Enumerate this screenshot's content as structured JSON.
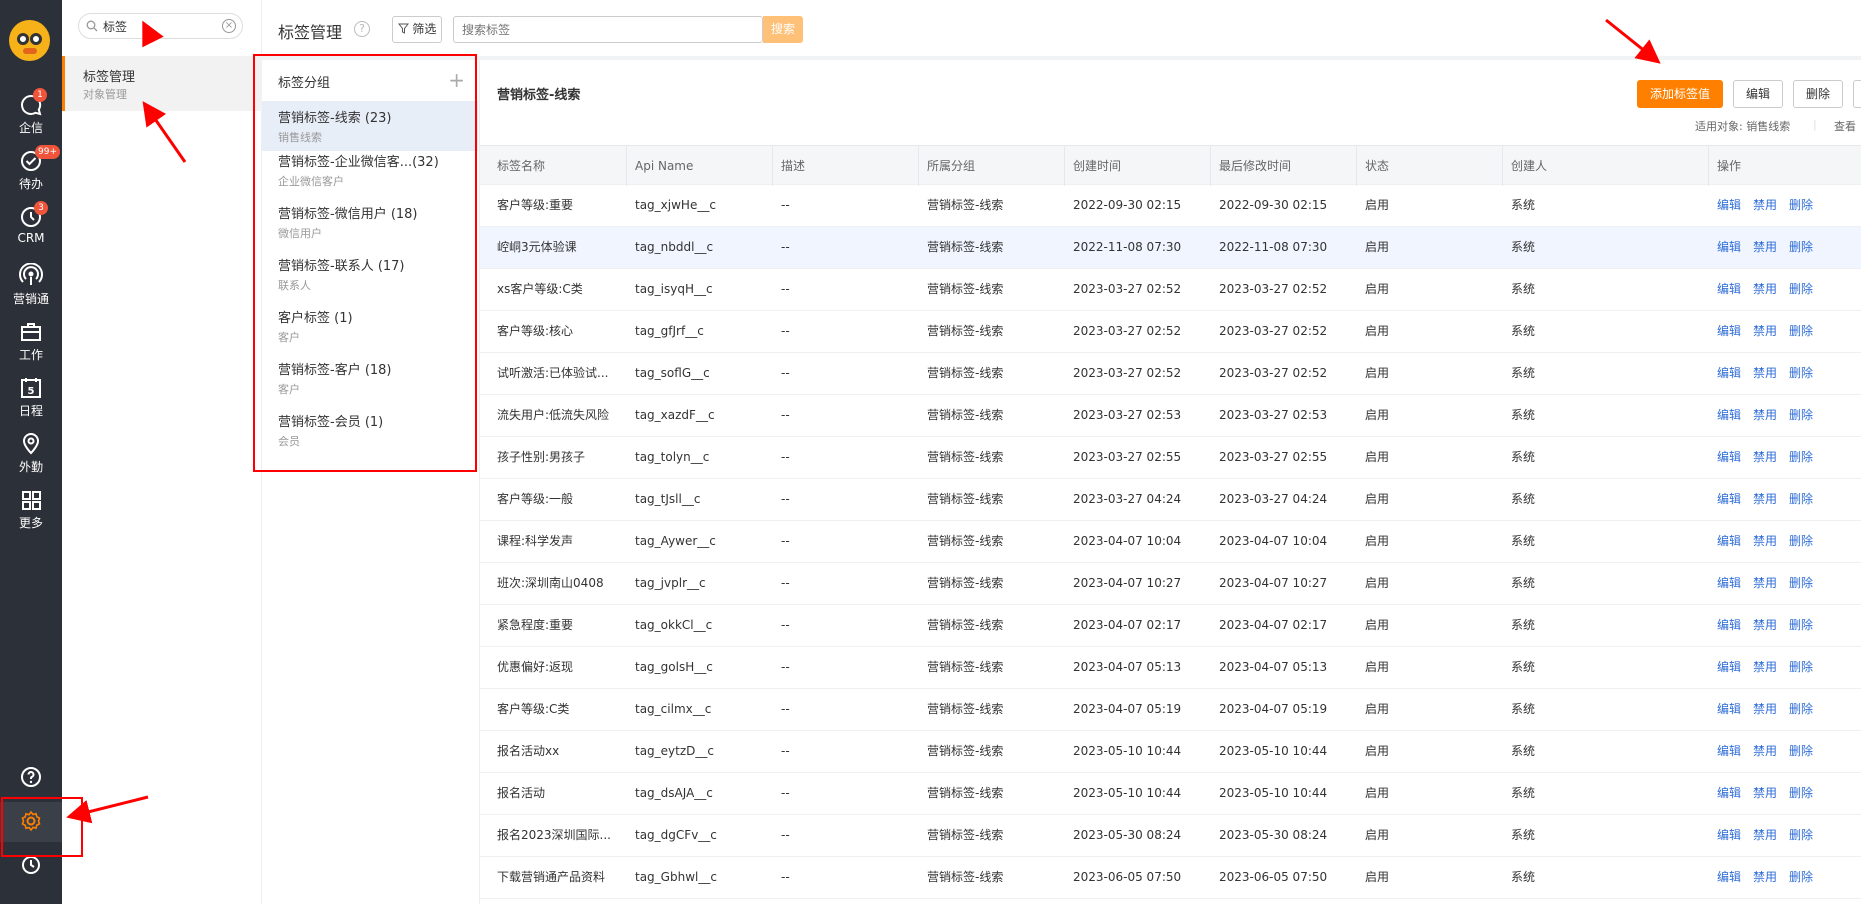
{
  "app": {
    "logo": "app-logo"
  },
  "rail": {
    "items": [
      {
        "label": "企信",
        "icon": "chat-icon",
        "badge": "1"
      },
      {
        "label": "待办",
        "icon": "check-circle-icon",
        "badge": "99+"
      },
      {
        "label": "CRM",
        "icon": "clock-icon",
        "badge": "3"
      },
      {
        "label": "营销通",
        "icon": "broadcast-icon",
        "badge": ""
      },
      {
        "label": "工作",
        "icon": "briefcase-icon",
        "badge": ""
      },
      {
        "label": "日程",
        "icon": "calendar-icon",
        "badge": "",
        "day": "5"
      },
      {
        "label": "外勤",
        "icon": "location-pin-icon",
        "badge": ""
      },
      {
        "label": "更多",
        "icon": "grid-icon",
        "badge": ""
      }
    ],
    "bottom": [
      "help-icon",
      "gear-icon",
      "history-icon"
    ]
  },
  "panel": {
    "search_value": "标签",
    "nav": {
      "title": "标签管理",
      "subtitle": "对象管理"
    }
  },
  "header": {
    "title": "标签管理",
    "help": "?",
    "filter_label": "筛选",
    "search_placeholder": "搜索标签",
    "search_button": "搜索"
  },
  "groups": {
    "header": "标签分组",
    "add": "+",
    "items": [
      {
        "name": "营销标签-线索 (23)",
        "desc": "销售线索",
        "active": true
      },
      {
        "name": "营销标签-企业微信客...(32)",
        "desc": "企业微信客户",
        "active": false
      },
      {
        "name": "营销标签-微信用户 (18)",
        "desc": "微信用户",
        "active": false
      },
      {
        "name": "营销标签-联系人 (17)",
        "desc": "联系人",
        "active": false
      },
      {
        "name": "客户标签 (1)",
        "desc": "客户",
        "active": false
      },
      {
        "name": "营销标签-客户 (18)",
        "desc": "客户",
        "active": false
      },
      {
        "name": "营销标签-会员 (1)",
        "desc": "会员",
        "active": false
      }
    ]
  },
  "main": {
    "title": "营销标签-线索",
    "add_button": "添加标签值",
    "edit_button": "编辑",
    "delete_button": "删除",
    "applies_to": "适用对象: 销售线索",
    "view": "查看"
  },
  "table": {
    "headers": [
      "标签名称",
      "Api Name",
      "描述",
      "所属分组",
      "创建时间",
      "最后修改时间",
      "状态",
      "创建人",
      "操作"
    ],
    "actions": [
      "编辑",
      "禁用",
      "删除"
    ],
    "rows": [
      [
        "客户等级:重要",
        "tag_xjwHe__c",
        "--",
        "营销标签-线索",
        "2022-09-30 02:15",
        "2022-09-30 02:15",
        "启用",
        "系统"
      ],
      [
        "崆峒3元体验课",
        "tag_nbddl__c",
        "--",
        "营销标签-线索",
        "2022-11-08 07:30",
        "2022-11-08 07:30",
        "启用",
        "系统"
      ],
      [
        "xs客户等级:C类",
        "tag_isyqH__c",
        "--",
        "营销标签-线索",
        "2023-03-27 02:52",
        "2023-03-27 02:52",
        "启用",
        "系统"
      ],
      [
        "客户等级:核心",
        "tag_gfJrf__c",
        "--",
        "营销标签-线索",
        "2023-03-27 02:52",
        "2023-03-27 02:52",
        "启用",
        "系统"
      ],
      [
        "试听激活:已体验试...",
        "tag_soflG__c",
        "--",
        "营销标签-线索",
        "2023-03-27 02:52",
        "2023-03-27 02:52",
        "启用",
        "系统"
      ],
      [
        "流失用户:低流失风险",
        "tag_xazdF__c",
        "--",
        "营销标签-线索",
        "2023-03-27 02:53",
        "2023-03-27 02:53",
        "启用",
        "系统"
      ],
      [
        "孩子性别:男孩子",
        "tag_tolyn__c",
        "--",
        "营销标签-线索",
        "2023-03-27 02:55",
        "2023-03-27 02:55",
        "启用",
        "系统"
      ],
      [
        "客户等级:一般",
        "tag_tJsll__c",
        "--",
        "营销标签-线索",
        "2023-03-27 04:24",
        "2023-03-27 04:24",
        "启用",
        "系统"
      ],
      [
        "课程:科学发声",
        "tag_Aywer__c",
        "--",
        "营销标签-线索",
        "2023-04-07 10:04",
        "2023-04-07 10:04",
        "启用",
        "系统"
      ],
      [
        "班次:深圳南山0408",
        "tag_jvplr__c",
        "--",
        "营销标签-线索",
        "2023-04-07 10:27",
        "2023-04-07 10:27",
        "启用",
        "系统"
      ],
      [
        "紧急程度:重要",
        "tag_okkCl__c",
        "--",
        "营销标签-线索",
        "2023-04-07 02:17",
        "2023-04-07 02:17",
        "启用",
        "系统"
      ],
      [
        "优惠偏好:返现",
        "tag_golsH__c",
        "--",
        "营销标签-线索",
        "2023-04-07 05:13",
        "2023-04-07 05:13",
        "启用",
        "系统"
      ],
      [
        "客户等级:C类",
        "tag_cilmx__c",
        "--",
        "营销标签-线索",
        "2023-04-07 05:19",
        "2023-04-07 05:19",
        "启用",
        "系统"
      ],
      [
        "报名活动xx",
        "tag_eytzD__c",
        "--",
        "营销标签-线索",
        "2023-05-10 10:44",
        "2023-05-10 10:44",
        "启用",
        "系统"
      ],
      [
        "报名活动",
        "tag_dsAJA__c",
        "--",
        "营销标签-线索",
        "2023-05-10 10:44",
        "2023-05-10 10:44",
        "启用",
        "系统"
      ],
      [
        "报名2023深圳国际...",
        "tag_dgCFv__c",
        "--",
        "营销标签-线索",
        "2023-05-30 08:24",
        "2023-05-30 08:24",
        "启用",
        "系统"
      ],
      [
        "下载营销通产品资料",
        "tag_Gbhwl__c",
        "--",
        "营销标签-线索",
        "2023-06-05 07:50",
        "2023-06-05 07:50",
        "启用",
        "系统"
      ]
    ]
  },
  "colors": {
    "accent": "#ff8000",
    "link": "#2f6dd8",
    "rail": "#2c3038",
    "annotation": "#ff0000"
  }
}
